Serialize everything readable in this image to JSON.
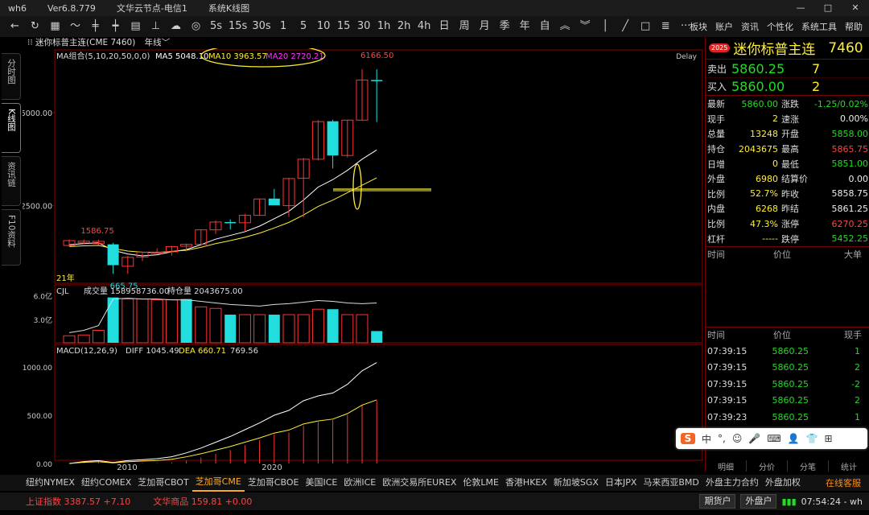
{
  "titlebar": {
    "app": "wh6",
    "version": "Ver6.8.779",
    "server": "文华云节点-电信1",
    "window_name": "系统K线图"
  },
  "toolbar": {
    "periods": [
      "5s",
      "15s",
      "30s",
      "1",
      "5",
      "10",
      "15",
      "30",
      "1h",
      "2h",
      "4h",
      "日",
      "周",
      "月",
      "季",
      "年",
      "自"
    ],
    "menu": [
      "板块",
      "账户",
      "资讯",
      "个性化",
      "系统工具",
      "帮助"
    ]
  },
  "left_tabs": [
    "分时图",
    "K线图",
    "资讯链",
    "F10资料"
  ],
  "chart": {
    "instrument_line": "迷你标普主连(CME 7460)",
    "period_label": "年线",
    "ma_group": "MA组合(5,10,20,50,0,0)",
    "ma5": "MA5 5048.10",
    "ma10": "MA10 3963.57",
    "ma20": "MA20 2720.21",
    "delay": "Delay",
    "high_label": "6166.50",
    "low_label": "665.75",
    "first_label": "1586.75",
    "year_label": "21年",
    "y_ticks": [
      "5000.00",
      "2500.00"
    ],
    "vol_header": "CJL",
    "vol_total": "成交量 158958736.00",
    "vol_oi": "持仓量 2043675.00",
    "vol_ticks": [
      "6.0亿",
      "3.0亿"
    ],
    "macd_header": "MACD(12,26,9)",
    "diff": "DIFF 1045.49",
    "dea": "DEA 660.71",
    "macd_val": "769.56",
    "macd_ticks": [
      "1000.00",
      "500.00",
      "0.00"
    ],
    "x_ticks": [
      "2010",
      "2020"
    ]
  },
  "chart_data": {
    "type": "candlestick",
    "candles": [
      {
        "o": 1430,
        "h": 1590,
        "l": 1400,
        "c": 1560,
        "up": true
      },
      {
        "o": 1500,
        "h": 1590,
        "l": 1460,
        "c": 1545,
        "up": true
      },
      {
        "o": 1480,
        "h": 1586.75,
        "l": 1440,
        "c": 1540,
        "up": true
      },
      {
        "o": 1460,
        "h": 1500,
        "l": 665.75,
        "c": 900,
        "up": false
      },
      {
        "o": 870,
        "h": 1150,
        "l": 665.75,
        "c": 1110,
        "up": true
      },
      {
        "o": 1120,
        "h": 1230,
        "l": 1010,
        "c": 1250,
        "up": true
      },
      {
        "o": 1250,
        "h": 1350,
        "l": 1250,
        "c": 1250,
        "up": true
      },
      {
        "o": 1260,
        "h": 1420,
        "l": 1160,
        "c": 1400,
        "up": true
      },
      {
        "o": 1410,
        "h": 1480,
        "l": 1270,
        "c": 1460,
        "up": true
      },
      {
        "o": 1460,
        "h": 1860,
        "l": 1420,
        "c": 1850,
        "up": true
      },
      {
        "o": 1850,
        "h": 2100,
        "l": 1740,
        "c": 2060,
        "up": true
      },
      {
        "o": 2060,
        "h": 2130,
        "l": 1860,
        "c": 2040,
        "up": false
      },
      {
        "o": 2040,
        "h": 2280,
        "l": 1820,
        "c": 2240,
        "up": true
      },
      {
        "o": 2240,
        "h": 2690,
        "l": 2230,
        "c": 2680,
        "up": true
      },
      {
        "o": 2690,
        "h": 2950,
        "l": 2530,
        "c": 2510,
        "up": false
      },
      {
        "o": 2500,
        "h": 3250,
        "l": 2200,
        "c": 3230,
        "up": true
      },
      {
        "o": 3240,
        "h": 3780,
        "l": 2190,
        "c": 3750,
        "up": true
      },
      {
        "o": 3750,
        "h": 4800,
        "l": 3720,
        "c": 4760,
        "up": true
      },
      {
        "o": 4770,
        "h": 4810,
        "l": 3500,
        "c": 3850,
        "up": false
      },
      {
        "o": 3850,
        "h": 4810,
        "l": 3800,
        "c": 4800,
        "up": true
      },
      {
        "o": 4800,
        "h": 6166.5,
        "l": 4800,
        "c": 5880,
        "up": true
      },
      {
        "o": 5880,
        "h": 6166.5,
        "l": 4750,
        "c": 5860,
        "up": false
      }
    ],
    "volumes": [
      0.9,
      1.0,
      1.6,
      5.8,
      5.6,
      5.6,
      5.5,
      5.5,
      5.6,
      4.6,
      4.4,
      3.6,
      3.6,
      3.6,
      3.6,
      3.6,
      3.6,
      4.3,
      4.3,
      3.6,
      3.6,
      1.5
    ],
    "vol_up": [
      true,
      true,
      true,
      false,
      true,
      true,
      true,
      true,
      false,
      true,
      true,
      false,
      true,
      true,
      false,
      true,
      true,
      true,
      false,
      true,
      true,
      false
    ],
    "macd_bars": [
      0,
      5,
      10,
      0,
      5,
      5,
      5,
      10,
      30,
      60,
      100,
      140,
      190,
      240,
      300,
      320,
      390,
      430,
      450,
      500,
      600,
      650
    ],
    "diff_line": [
      0,
      20,
      30,
      10,
      30,
      40,
      50,
      70,
      110,
      160,
      220,
      280,
      350,
      420,
      500,
      550,
      650,
      700,
      730,
      820,
      960,
      1045.49
    ],
    "ma_line": [
      1450,
      1480,
      1500,
      1300,
      1200,
      1150,
      1180,
      1260,
      1320,
      1450,
      1600,
      1700,
      1800,
      1950,
      2150,
      2350,
      2650,
      3000,
      3200,
      3450,
      3750,
      4000
    ],
    "ma_slow": [
      1400,
      1420,
      1430,
      1350,
      1280,
      1250,
      1240,
      1270,
      1300,
      1380,
      1480,
      1560,
      1650,
      1760,
      1900,
      2050,
      2250,
      2480,
      2650,
      2850,
      3050,
      3250
    ],
    "ylim": [
      500,
      6300
    ]
  },
  "quote": {
    "badge": "2025",
    "name": "迷你标普主连",
    "code": "7460",
    "ask_label": "卖出",
    "ask_price": "5860.25",
    "ask_qty": "7",
    "bid_label": "买入",
    "bid_price": "5860.00",
    "bid_qty": "2",
    "rows": [
      {
        "k1": "最新",
        "v1": "5860.00",
        "c1": "green",
        "k2": "涨跌",
        "v2": "-1.25/0.02%",
        "c2": "green"
      },
      {
        "k1": "现手",
        "v1": "2",
        "c1": "yellow",
        "k2": "速涨",
        "v2": "0.00%",
        "c2": "white"
      },
      {
        "k1": "总量",
        "v1": "13248",
        "c1": "yellow",
        "k2": "开盘",
        "v2": "5858.00",
        "c2": "green"
      },
      {
        "k1": "持仓",
        "v1": "2043675",
        "c1": "yellow",
        "k2": "最高",
        "v2": "5865.75",
        "c2": "red"
      },
      {
        "k1": "日增",
        "v1": "0",
        "c1": "yellow",
        "k2": "最低",
        "v2": "5851.00",
        "c2": "green"
      },
      {
        "k1": "外盘",
        "v1": "6980",
        "c1": "yellow",
        "k2": "结算价",
        "v2": "0.00",
        "c2": "white"
      },
      {
        "k1": "比例",
        "v1": "52.7%",
        "c1": "yellow",
        "k2": "昨收",
        "v2": "5858.75",
        "c2": "white"
      },
      {
        "k1": "内盘",
        "v1": "6268",
        "c1": "yellow",
        "k2": "昨结",
        "v2": "5861.25",
        "c2": "white"
      },
      {
        "k1": "比例",
        "v1": "47.3%",
        "c1": "yellow",
        "k2": "涨停",
        "v2": "6270.25",
        "c2": "red"
      },
      {
        "k1": "杠杆",
        "v1": "-----",
        "c1": "yellow",
        "k2": "跌停",
        "v2": "5452.25",
        "c2": "green"
      }
    ],
    "bigorder_header": [
      "时间",
      "价位",
      "大单"
    ],
    "tick_header": [
      "时间",
      "价位",
      "现手"
    ],
    "ticks": [
      {
        "t": "07:39:15",
        "p": "5860.25",
        "q": "1"
      },
      {
        "t": "07:39:15",
        "p": "5860.25",
        "q": "2"
      },
      {
        "t": "07:39:15",
        "p": "5860.25",
        "q": "-2"
      },
      {
        "t": "07:39:15",
        "p": "5860.25",
        "q": "2"
      },
      {
        "t": "07:39:23",
        "p": "5860.25",
        "q": "1"
      }
    ],
    "bottom_tabs": [
      "明细",
      "分价",
      "分笔",
      "统计"
    ]
  },
  "ime": [
    "中",
    "°,",
    "☺",
    "🎤",
    "⌨",
    "👤",
    "👕",
    "⊞"
  ],
  "market_tabs": [
    "纽约NYMEX",
    "纽约COMEX",
    "芝加哥CBOT",
    "芝加哥CME",
    "芝加哥CBOE",
    "美国ICE",
    "欧洲ICE",
    "欧洲交易所EUREX",
    "伦敦LME",
    "香港HKEX",
    "新加坡SGX",
    "日本JPX",
    "马来西亚BMD",
    "外盘主力合约",
    "外盘加权"
  ],
  "market_active": "芝加哥CME",
  "online_service": "在线客服",
  "status": {
    "index1": "上证指数 3387.57 +7.10",
    "index2": "文华商品 159.81 +0.00",
    "btn1": "期货户",
    "btn2": "外盘户",
    "time": "07:54:24 - wh"
  },
  "colors": {
    "up": "#ff3333",
    "down": "#22dddd",
    "ma5": "#ffffff",
    "ma10": "#ffee33",
    "ma20": "#ff33ff",
    "grid": "#8b0000"
  }
}
